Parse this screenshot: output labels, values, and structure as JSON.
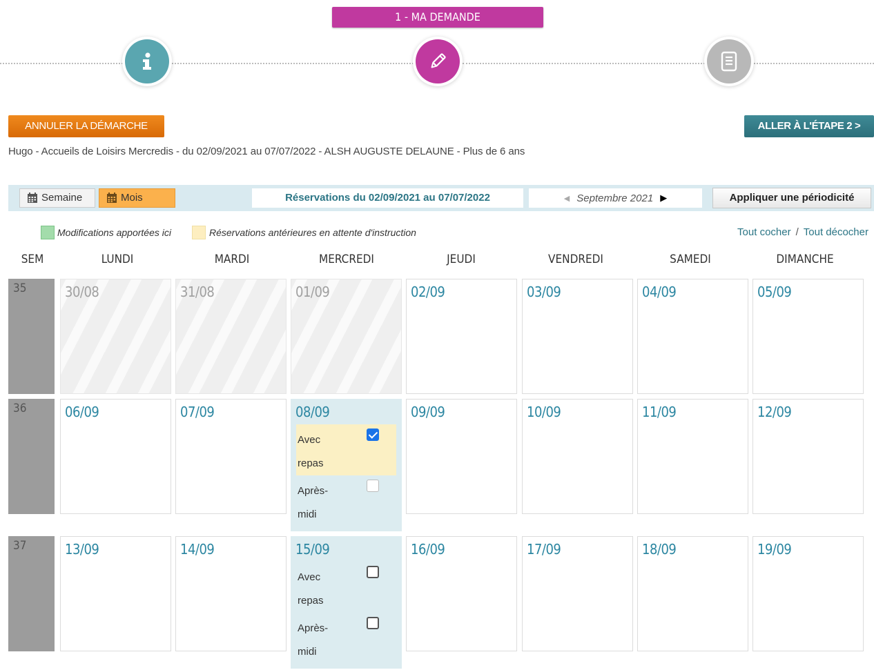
{
  "stepper": {
    "title": "1 - MA DEMANDE",
    "steps": [
      {
        "icon": "info-icon",
        "color": "#5aa6b0"
      },
      {
        "icon": "pencil-icon",
        "color": "#c0399f"
      },
      {
        "icon": "document-icon",
        "color": "#b8b8b8"
      }
    ]
  },
  "actions": {
    "cancel_label": "ANNULER LA DÉMARCHE",
    "next_label": "ALLER À L'ÉTAPE 2 >"
  },
  "summary": "Hugo - Accueils de Loisirs Mercredis - du 02/09/2021 au 07/07/2022 - ALSH AUGUSTE DELAUNE - Plus de 6 ans",
  "toolbar": {
    "week_label": "Semaine",
    "month_label": "Mois",
    "range_label": "Réservations du 02/09/2021 au 07/07/2022",
    "month_name": "Septembre 2021",
    "periodicity_label": "Appliquer une périodicité"
  },
  "legend": {
    "modified": "Modifications apportées ici",
    "pending": "Réservations antérieures en attente d'instruction",
    "check_all": "Tout cocher",
    "separator": "/",
    "uncheck_all": "Tout décocher"
  },
  "colors": {
    "accent_purple": "#c0399f",
    "accent_teal": "#2c6f7a",
    "accent_orange": "#e1730f",
    "date_blue": "#2b86a1"
  },
  "columns": [
    "SEM",
    "LUNDI",
    "MARDI",
    "MERCREDI",
    "JEUDI",
    "VENDREDI",
    "SAMEDI",
    "DIMANCHE"
  ],
  "weeks": [
    {
      "num": "35",
      "days": [
        {
          "date": "30/08",
          "past": true
        },
        {
          "date": "31/08",
          "past": true
        },
        {
          "date": "01/09",
          "past": true
        },
        {
          "date": "02/09"
        },
        {
          "date": "03/09"
        },
        {
          "date": "04/09"
        },
        {
          "date": "05/09"
        }
      ]
    },
    {
      "num": "36",
      "days": [
        {
          "date": "06/09"
        },
        {
          "date": "07/09"
        },
        {
          "date": "08/09",
          "active": true,
          "options": [
            {
              "label": "Avec repas",
              "checked": true,
              "pending": true
            },
            {
              "label": "Après-midi",
              "checked": false,
              "disabled": true
            }
          ]
        },
        {
          "date": "09/09"
        },
        {
          "date": "10/09"
        },
        {
          "date": "11/09"
        },
        {
          "date": "12/09"
        }
      ]
    },
    {
      "num": "37",
      "days": [
        {
          "date": "13/09"
        },
        {
          "date": "14/09"
        },
        {
          "date": "15/09",
          "active": true,
          "options": [
            {
              "label": "Avec repas",
              "checked": false
            },
            {
              "label": "Après-midi",
              "checked": false
            }
          ]
        },
        {
          "date": "16/09"
        },
        {
          "date": "17/09"
        },
        {
          "date": "18/09"
        },
        {
          "date": "19/09"
        }
      ]
    }
  ]
}
